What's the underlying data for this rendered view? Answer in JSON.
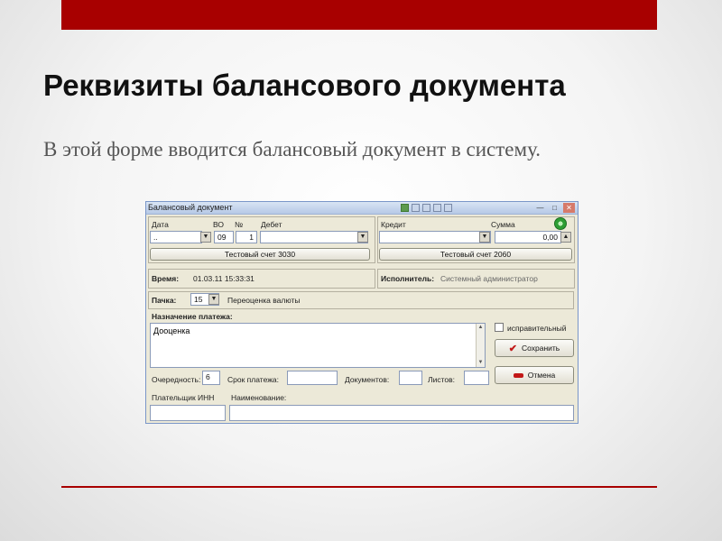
{
  "slide": {
    "title": "Реквизиты балансового документа",
    "subtitle": "В этой форме вводится балансовый документ в систему."
  },
  "window": {
    "title": "Балансовый документ",
    "debit": {
      "date_label": "Дата",
      "vo_label": "ВО",
      "number_label": "№",
      "account_label": "Дебет",
      "date_value": "..",
      "vo_value": "09",
      "number_value": "1",
      "account_value": "",
      "account_button": "Тестовый счет 3030"
    },
    "credit": {
      "account_label": "Кредит",
      "sum_label": "Сумма",
      "account_value": "",
      "sum_value": "0,00",
      "account_button": "Тестовый счет 2060"
    },
    "time": {
      "label": "Время:",
      "value": "01.03.11  15:33:31"
    },
    "executor": {
      "label": "Исполнитель:",
      "value": "Системный администратор"
    },
    "batch": {
      "label": "Пачка:",
      "value": "15",
      "description": "Переоценка валюты"
    },
    "purpose": {
      "label": "Назначение платежа:",
      "value": "Дооценка"
    },
    "corrective_label": "исправительный",
    "save_label": "Сохранить",
    "cancel_label": "Отмена",
    "bottom": {
      "priority_label": "Очередность:",
      "priority_value": "6",
      "due_label": "Срок платежа:",
      "due_value": "",
      "docs_label": "Документов:",
      "docs_value": "",
      "sheets_label": "Листов:",
      "sheets_value": ""
    },
    "payer": {
      "inn_label": "Плательщик ИНН",
      "name_label": "Наименование:",
      "inn_value": "",
      "name_value": ""
    }
  },
  "colors": {
    "accent": "#a80000",
    "window_bg": "#ece9d8"
  }
}
